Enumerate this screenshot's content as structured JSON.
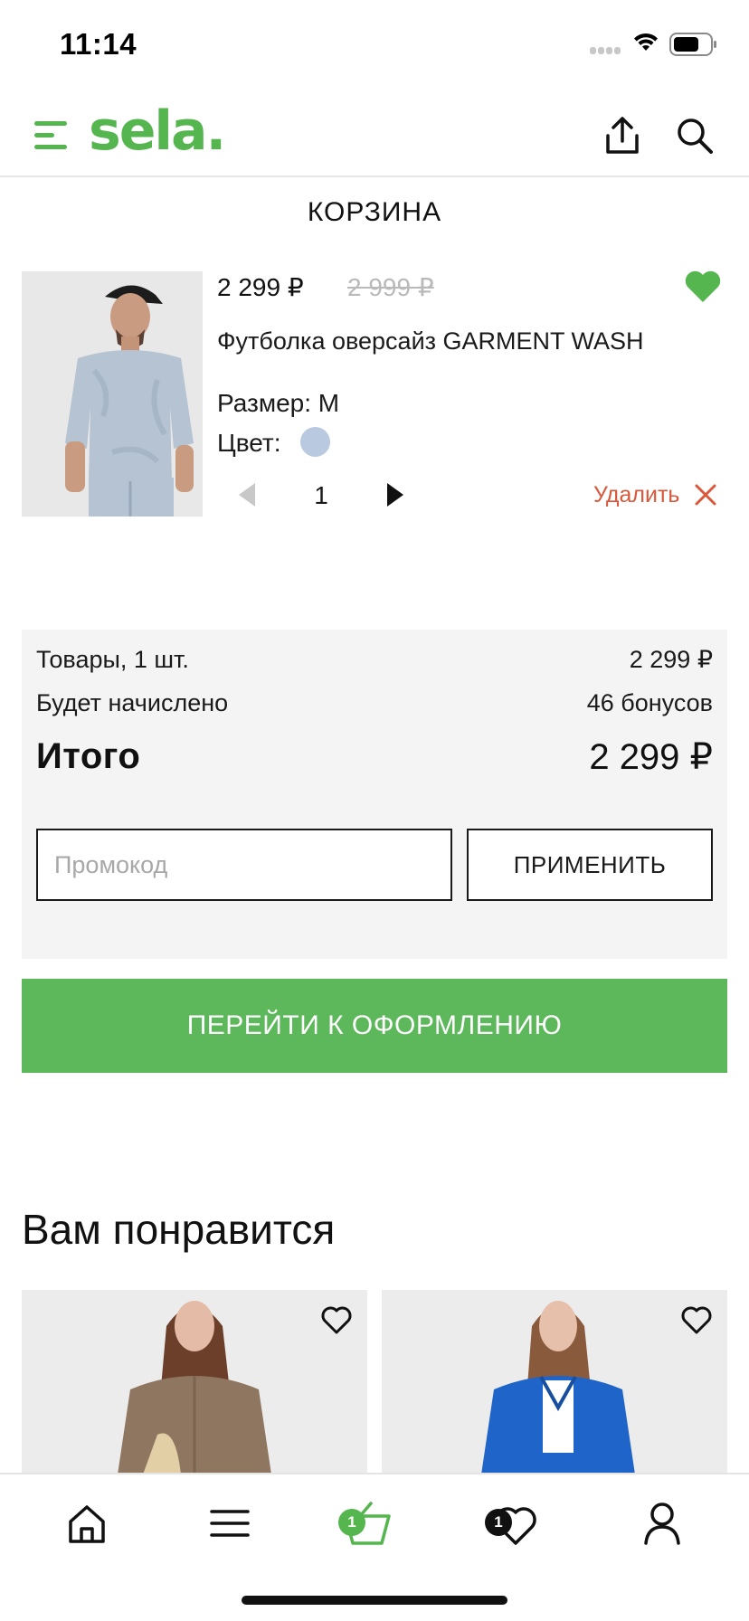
{
  "status_bar": {
    "time": "11:14"
  },
  "header": {
    "logo": "sela.",
    "brand_color": "#55b54e",
    "icons": [
      "menu-icon",
      "share-icon",
      "search-icon"
    ]
  },
  "page": {
    "title": "КОРЗИНА"
  },
  "cart_item": {
    "price": "2 299 ₽",
    "old_price": "2 999 ₽",
    "name": "Футболка оверсайз GARMENT WASH",
    "size": "Размер: M",
    "color_label": "Цвет:",
    "color_swatch": "#b9c9e0",
    "quantity": "1",
    "remove_label": "Удалить",
    "favorited": true
  },
  "summary": {
    "items_label": "Товары, 1 шт.",
    "items_value": "2 299 ₽",
    "bonus_label": "Будет начислено",
    "bonus_value": "46 бонусов",
    "total_label": "Итого",
    "total_value": "2 299 ₽",
    "promo_placeholder": "Промокод",
    "promo_value": "",
    "apply_label": "ПРИМЕНИТЬ"
  },
  "checkout": {
    "label": "ПЕРЕЙТИ К ОФОРМЛЕНИЮ",
    "color": "#5cb85a"
  },
  "recommendations": {
    "title": "Вам понравится",
    "cards": [
      {
        "image": "woman-in-brown-shirt"
      },
      {
        "image": "woman-in-blue-shirt"
      }
    ]
  },
  "tab_bar": {
    "tabs": [
      {
        "icon": "home-icon"
      },
      {
        "icon": "catalog-menu-icon"
      },
      {
        "icon": "cart-icon",
        "badge": "1",
        "active": true
      },
      {
        "icon": "favorites-heart-icon",
        "badge": "1"
      },
      {
        "icon": "profile-icon"
      }
    ]
  }
}
